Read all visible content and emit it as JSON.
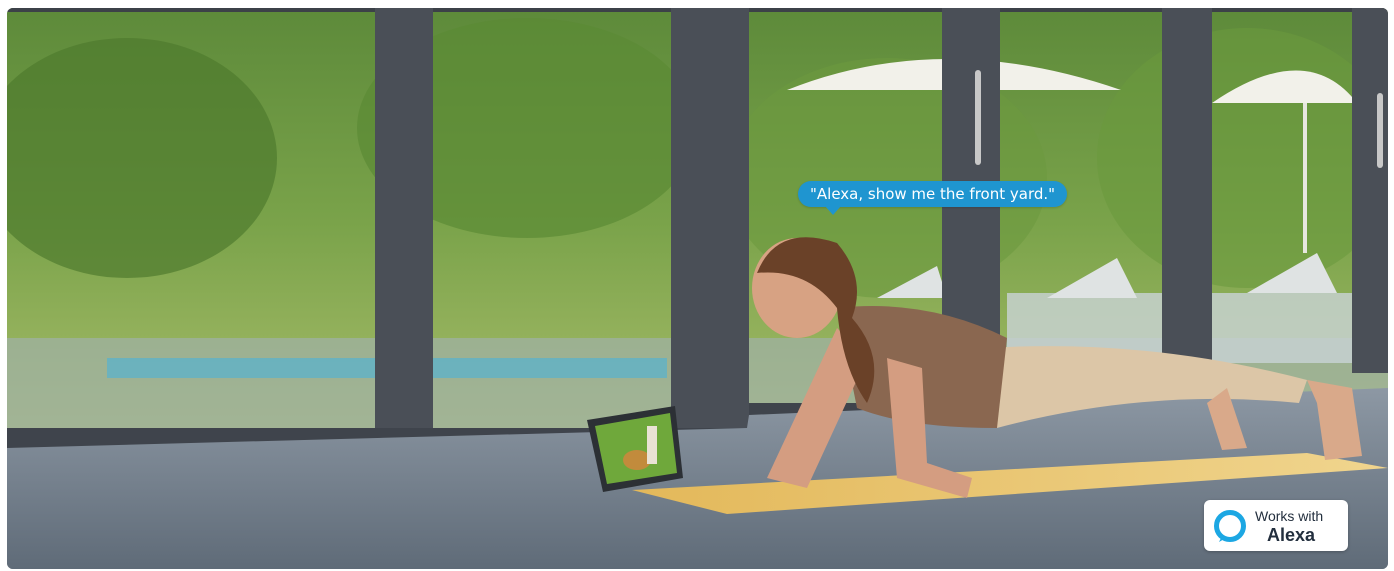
{
  "speech_bubble": {
    "text": "\"Alexa, show me the front yard.\""
  },
  "badge": {
    "line1": "Works with",
    "line2": "Alexa",
    "icon": "alexa-ring-icon",
    "ring_color": "#1ca7e3"
  },
  "colors": {
    "bubble_bg": "#1f95d0",
    "yoga_mat": "#e9c56a"
  }
}
